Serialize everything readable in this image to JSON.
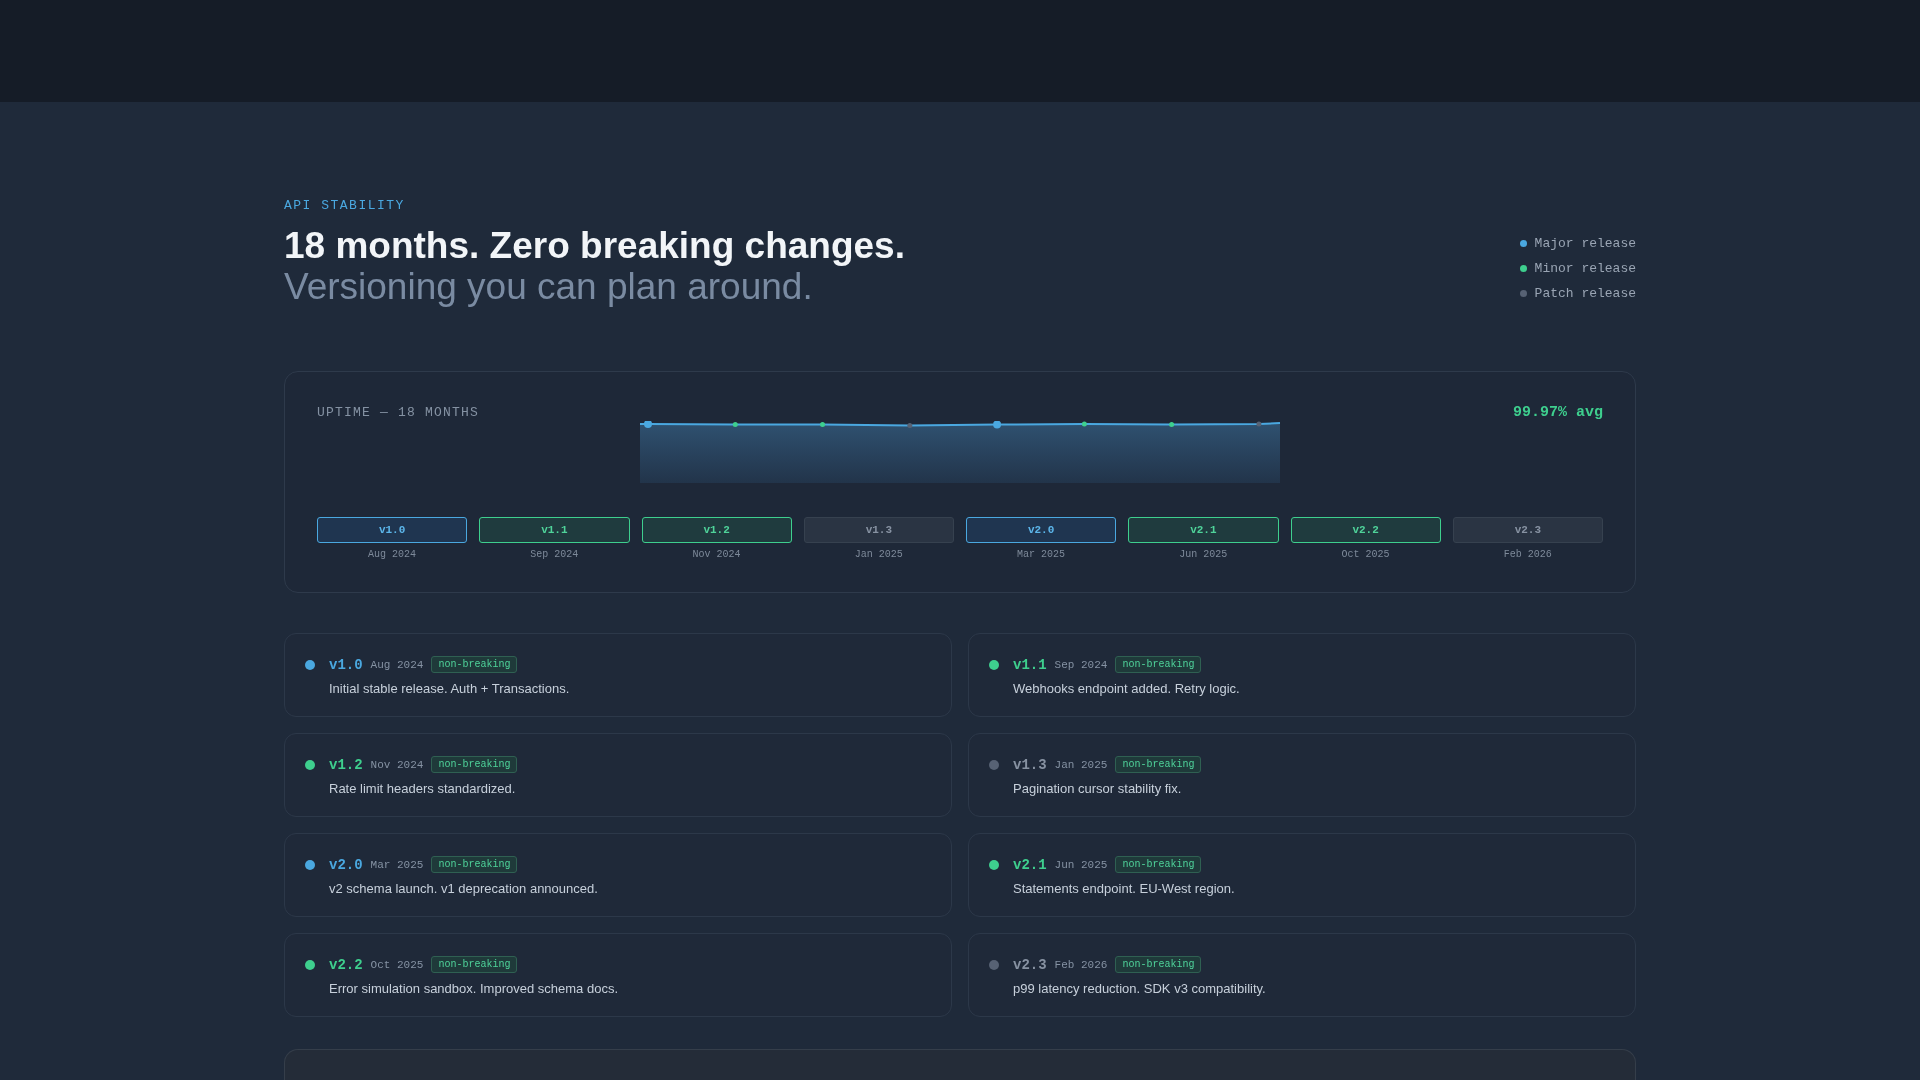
{
  "section": {
    "eyebrow": "API STABILITY",
    "headline": "18 months. Zero breaking changes.",
    "subheadline": "Versioning you can plan around."
  },
  "legend": [
    {
      "kind": "major",
      "label": "Major release"
    },
    {
      "kind": "minor",
      "label": "Minor release"
    },
    {
      "kind": "patch",
      "label": "Patch release"
    }
  ],
  "uptime": {
    "title": "UPTIME — 18 MONTHS",
    "average": "99.97% avg",
    "versions": [
      {
        "version": "v1.0",
        "date": "Aug 2024",
        "kind": "major"
      },
      {
        "version": "v1.1",
        "date": "Sep 2024",
        "kind": "minor"
      },
      {
        "version": "v1.2",
        "date": "Nov 2024",
        "kind": "minor"
      },
      {
        "version": "v1.3",
        "date": "Jan 2025",
        "kind": "patch"
      },
      {
        "version": "v2.0",
        "date": "Mar 2025",
        "kind": "major"
      },
      {
        "version": "v2.1",
        "date": "Jun 2025",
        "kind": "minor"
      },
      {
        "version": "v2.2",
        "date": "Oct 2025",
        "kind": "minor"
      },
      {
        "version": "v2.3",
        "date": "Feb 2026",
        "kind": "patch"
      }
    ]
  },
  "releases": [
    {
      "version": "v1.0",
      "date": "Aug 2024",
      "kind": "major",
      "badge": "non-breaking",
      "note": "Initial stable release. Auth + Transactions."
    },
    {
      "version": "v1.1",
      "date": "Sep 2024",
      "kind": "minor",
      "badge": "non-breaking",
      "note": "Webhooks endpoint added. Retry logic."
    },
    {
      "version": "v1.2",
      "date": "Nov 2024",
      "kind": "minor",
      "badge": "non-breaking",
      "note": "Rate limit headers standardized."
    },
    {
      "version": "v1.3",
      "date": "Jan 2025",
      "kind": "patch",
      "badge": "non-breaking",
      "note": "Pagination cursor stability fix."
    },
    {
      "version": "v2.0",
      "date": "Mar 2025",
      "kind": "major",
      "badge": "non-breaking",
      "note": "v2 schema launch. v1 deprecation announced."
    },
    {
      "version": "v2.1",
      "date": "Jun 2025",
      "kind": "minor",
      "badge": "non-breaking",
      "note": "Statements endpoint. EU-West region."
    },
    {
      "version": "v2.2",
      "date": "Oct 2025",
      "kind": "minor",
      "badge": "non-breaking",
      "note": "Error simulation sandbox. Improved schema docs."
    },
    {
      "version": "v2.3",
      "date": "Feb 2026",
      "kind": "patch",
      "badge": "non-breaking",
      "note": "p99 latency reduction. SDK v3 compatibility."
    }
  ]
}
